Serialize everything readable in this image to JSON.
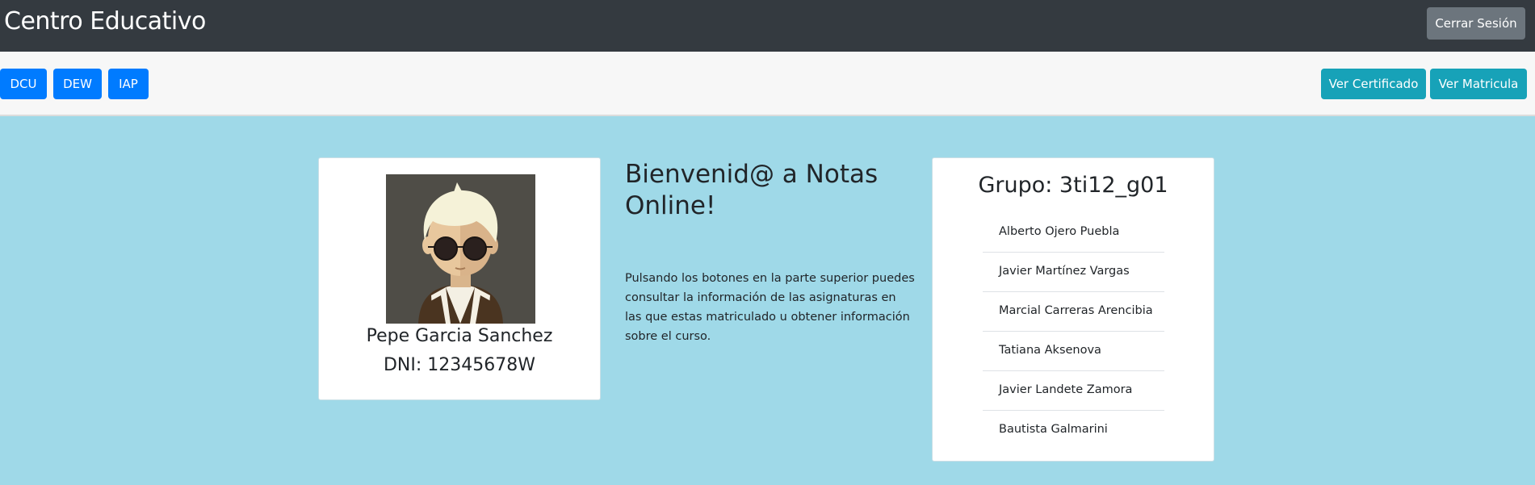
{
  "navbar": {
    "brand": "Centro Educativo",
    "logout_label": "Cerrar Sesión"
  },
  "toolbar": {
    "subjects": [
      "DCU",
      "DEW",
      "IAP"
    ],
    "certificate_label": "Ver Certificado",
    "enrollment_label": "Ver Matricula"
  },
  "profile": {
    "name": "Pepe Garcia Sanchez",
    "dni": "DNI: 12345678W"
  },
  "welcome": {
    "title": "Bienvenid@ a Notas Online!",
    "text": "Pulsando los botones en la parte superior puedes consultar la información de las asignaturas en las que estas matriculado u obtener información sobre el curso."
  },
  "group": {
    "title": "Grupo: 3ti12_g01",
    "members": [
      "Alberto Ojero Puebla",
      "Javier Martínez Vargas",
      "Marcial Carreras Arencibia",
      "Tatiana Aksenova",
      "Javier Landete Zamora",
      "Bautista Galmarini"
    ]
  },
  "colors": {
    "navbar": "#343a40",
    "primary": "#007bff",
    "info": "#17a2b8",
    "secondary": "#6c757d",
    "page_background": "#9fd9e8"
  }
}
